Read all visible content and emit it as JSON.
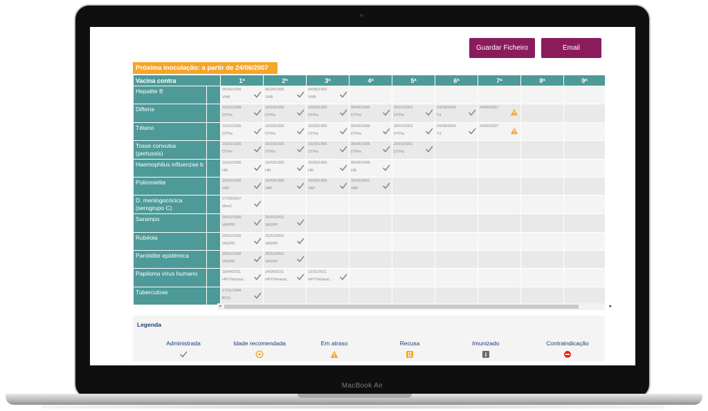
{
  "device": {
    "label": "MacBook Air"
  },
  "toolbar": {
    "save_label": "Guardar Ficheiro",
    "email_label": "Email"
  },
  "banner": {
    "text": "Próxima inoculação: a partir de 24/06/2007"
  },
  "table": {
    "vaccine_header": "Vacina contra",
    "dose_headers": [
      "1ª",
      "2ª",
      "3ª",
      "4ª",
      "5ª",
      "6ª",
      "7ª",
      "8ª",
      "9ª"
    ],
    "rows": [
      {
        "name": "Hepatite B",
        "doses": [
          {
            "date": "05/05/1995",
            "code": "VHB",
            "status": "check"
          },
          {
            "date": "06/04/1995",
            "code": "VHB",
            "status": "check"
          },
          {
            "date": "04/05/1995",
            "code": "VHB",
            "status": "check"
          }
        ]
      },
      {
        "name": "Difteria",
        "doses": [
          {
            "date": "16/01/1995",
            "code": "DTPw",
            "status": "check"
          },
          {
            "date": "16/03/1995",
            "code": "DTPw",
            "status": "check"
          },
          {
            "date": "15/05/1995",
            "code": "DTPw",
            "status": "check"
          },
          {
            "date": "09/04/1996",
            "code": "DTPw",
            "status": "check"
          },
          {
            "date": "25/01/2001",
            "code": "DTPw",
            "status": "check"
          },
          {
            "date": "24/06/2004",
            "code": "Td",
            "status": "check"
          },
          {
            "date": "24/06/2007",
            "code": "",
            "status": "warning"
          }
        ]
      },
      {
        "name": "Tétano",
        "doses": [
          {
            "date": "16/01/1995",
            "code": "DTPw",
            "status": "check"
          },
          {
            "date": "16/03/1995",
            "code": "DTPw",
            "status": "check"
          },
          {
            "date": "15/05/1995",
            "code": "DTPw",
            "status": "check"
          },
          {
            "date": "09/04/1996",
            "code": "DTPw",
            "status": "check"
          },
          {
            "date": "25/01/2001",
            "code": "DTPw",
            "status": "check"
          },
          {
            "date": "24/06/2004",
            "code": "Td",
            "status": "check"
          },
          {
            "date": "24/06/2007",
            "code": "",
            "status": "warning"
          }
        ]
      },
      {
        "name": "Tosse convulsa (pertussis)",
        "doses": [
          {
            "date": "16/01/1995",
            "code": "DTPw",
            "status": "check"
          },
          {
            "date": "16/03/1995",
            "code": "DTPw",
            "status": "check"
          },
          {
            "date": "15/05/1995",
            "code": "DTPw",
            "status": "check"
          },
          {
            "date": "09/04/1996",
            "code": "DTPw",
            "status": "check"
          },
          {
            "date": "25/01/2001",
            "code": "DTPw",
            "status": "check"
          }
        ]
      },
      {
        "name": "Haemophilus influenzae b",
        "doses": [
          {
            "date": "16/01/1995",
            "code": "Hib",
            "status": "check"
          },
          {
            "date": "16/03/1995",
            "code": "Hib",
            "status": "check"
          },
          {
            "date": "15/05/1995",
            "code": "Hib",
            "status": "check"
          },
          {
            "date": "09/04/1996",
            "code": "Hib",
            "status": "check"
          }
        ]
      },
      {
        "name": "Poliomielite",
        "doses": [
          {
            "date": "16/01/1995",
            "code": "VAP",
            "status": "check"
          },
          {
            "date": "16/03/1995",
            "code": "VAP",
            "status": "check"
          },
          {
            "date": "15/05/1995",
            "code": "VAP",
            "status": "check"
          },
          {
            "date": "25/01/2001",
            "code": "VAP",
            "status": "check"
          }
        ]
      },
      {
        "name": "D. meningocócica (serogrupo C)",
        "doses": [
          {
            "date": "27/03/2007",
            "code": "MenC",
            "status": "check"
          }
        ]
      },
      {
        "name": "Sarampo",
        "doses": [
          {
            "date": "25/01/1996",
            "code": "VASPR",
            "status": "check"
          },
          {
            "date": "25/01/2001",
            "code": "VASPR",
            "status": "check"
          }
        ]
      },
      {
        "name": "Rubéola",
        "doses": [
          {
            "date": "25/01/1996",
            "code": "VASPR",
            "status": "check"
          },
          {
            "date": "25/01/2001",
            "code": "VASPR",
            "status": "check"
          }
        ]
      },
      {
        "name": "Parotidite epidémica",
        "doses": [
          {
            "date": "25/01/1996",
            "code": "VASPR",
            "status": "check"
          },
          {
            "date": "25/01/2001",
            "code": "VASPR",
            "status": "check"
          }
        ]
      },
      {
        "name": "Papiloma vírus humano",
        "doses": [
          {
            "date": "18/04/2011",
            "code": "HPVTetraval...",
            "status": "check"
          },
          {
            "date": "24/06/2011",
            "code": "HPVTetraval...",
            "status": "check"
          },
          {
            "date": "10/11/2011",
            "code": "HPVTetraval...",
            "status": "check"
          }
        ]
      },
      {
        "name": "Tuberculose",
        "doses": [
          {
            "date": "17/11/1994",
            "code": "BCG",
            "status": "check"
          }
        ]
      }
    ]
  },
  "legend": {
    "title": "Legenda",
    "items": [
      {
        "label": "Administrada",
        "icon": "check-icon",
        "color": "#8a8a8a"
      },
      {
        "label": "Idade recomendada",
        "icon": "clock-icon",
        "color": "#f5a52a"
      },
      {
        "label": "Em atraso",
        "icon": "warning-icon",
        "color": "#f5a52a"
      },
      {
        "label": "Recusa",
        "icon": "refusal-icon",
        "color": "#f5a52a"
      },
      {
        "label": "Imunizado",
        "icon": "immunized-icon",
        "color": "#6a6a6a"
      },
      {
        "label": "Contraindicação",
        "icon": "contraindication-icon",
        "color": "#e2261c"
      }
    ]
  },
  "colors": {
    "accent": "#8a1c5c",
    "table_header": "#4d9a98",
    "banner": "#f5a52a"
  }
}
